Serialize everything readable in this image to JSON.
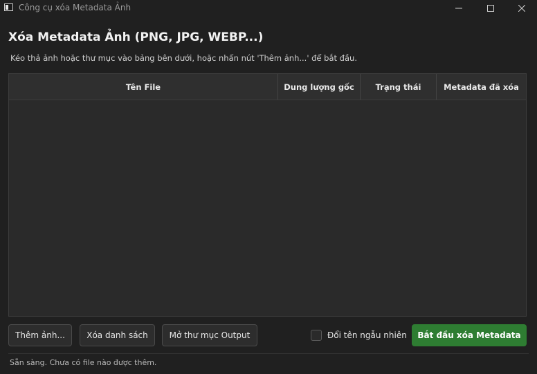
{
  "window": {
    "title": "Công cụ xóa Metadata Ảnh",
    "controls": [
      "minimize-icon",
      "maximize-icon",
      "close-icon"
    ]
  },
  "header": {
    "title": "Xóa Metadata Ảnh (PNG, JPG, WEBP...)",
    "instructions": "Kéo thả ảnh hoặc thư mục vào bảng bên dưới, hoặc nhấn nút 'Thêm ảnh...' để bắt đầu."
  },
  "table": {
    "columns": [
      "Tên File",
      "Dung lượng gốc",
      "Trạng thái",
      "Metadata đã xóa"
    ],
    "rows": []
  },
  "actions": {
    "add_label": "Thêm ảnh...",
    "clear_label": "Xóa danh sách",
    "open_output_label": "Mở thư mục Output",
    "random_rename_label": "Đổi tên ngẫu nhiên",
    "random_rename_checked": false,
    "start_label": "Bắt đầu xóa Metadata"
  },
  "status": {
    "text": "Sẵn sàng. Chưa có file nào được thêm."
  },
  "colors": {
    "background": "#202020",
    "accent": "#2e7d32"
  }
}
